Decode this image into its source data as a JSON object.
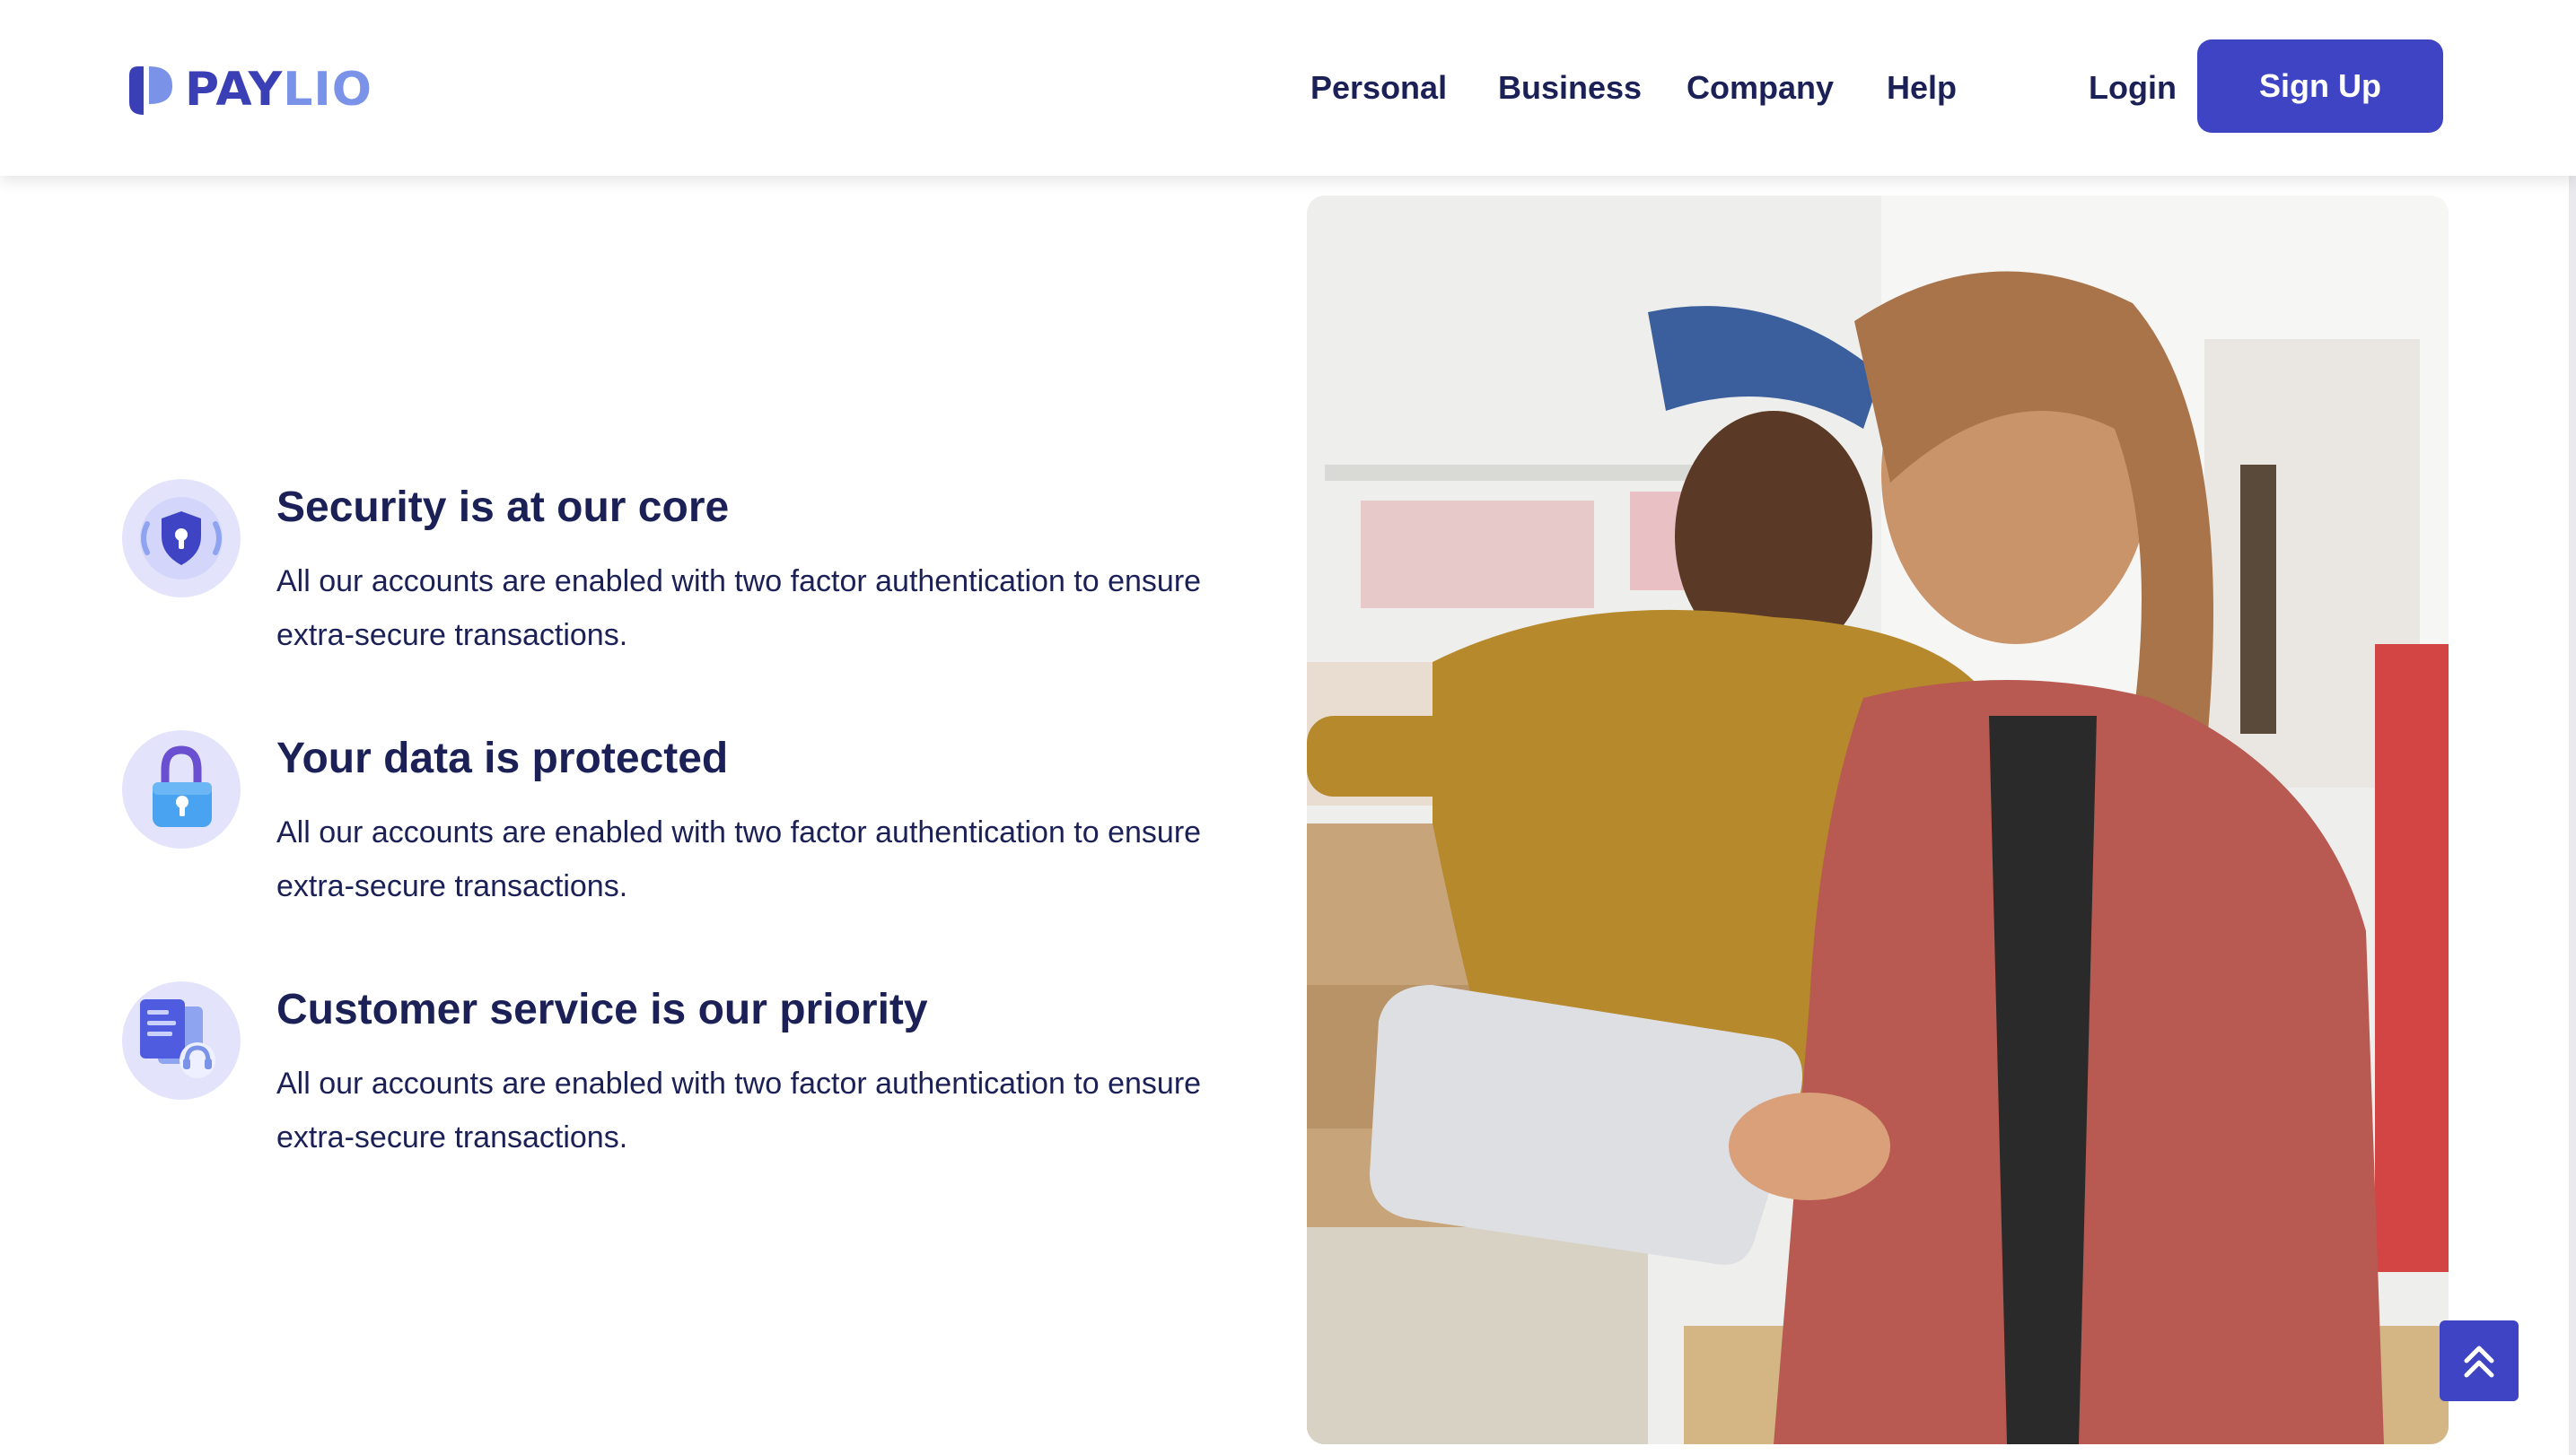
{
  "brand": {
    "name_part1": "PAY",
    "name_part2": "LIO",
    "primary_color": "#3f44c4",
    "accent_color": "#7a93e8",
    "text_color": "#1b2157"
  },
  "nav": {
    "items": [
      {
        "label": "Personal"
      },
      {
        "label": "Business"
      },
      {
        "label": "Company"
      },
      {
        "label": "Help"
      }
    ],
    "login_label": "Login",
    "signup_label": "Sign Up"
  },
  "features": [
    {
      "icon": "shield-lock-icon",
      "title": "Security is at our core",
      "description": "All our accounts are enabled with two factor authentication to ensure extra-secure transactions."
    },
    {
      "icon": "padlock-icon",
      "title": "Your data is protected",
      "description": "All our accounts are enabled with two factor authentication to ensure extra-secure transactions."
    },
    {
      "icon": "customer-support-icon",
      "title": "Customer service is our priority",
      "description": "All our accounts are enabled with two factor authentication to ensure extra-secure transactions."
    }
  ],
  "scroll_top_icon": "double-chevron-up-icon"
}
